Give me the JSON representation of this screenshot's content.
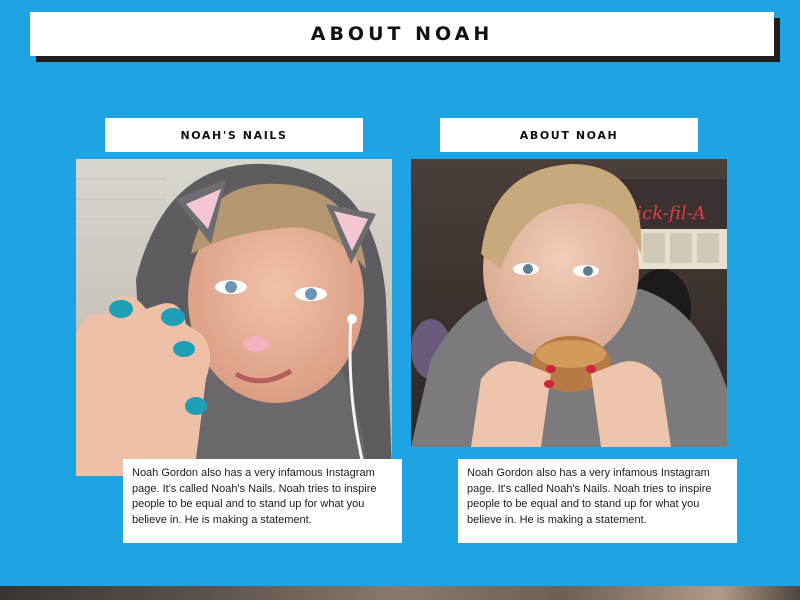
{
  "page": {
    "title": "ABOUT NOAH",
    "background_color": "#1fa4e3"
  },
  "cards": [
    {
      "header": "NOAH'S NAILS",
      "image_description_icon": "selfie-photo",
      "caption": "Noah Gordon also has a very infamous Instagram page. It's called Noah's Nails. Noah tries to inspire people to be equal and to stand up for what you believe in. He is making a statement."
    },
    {
      "header": "ABOUT NOAH",
      "image_description_icon": "eating-photo",
      "caption": "Noah Gordon also has a very infamous Instagram page. It's called Noah's Nails. Noah tries to inspire people to be equal and to stand up for what you believe in. He is making a statement."
    }
  ]
}
